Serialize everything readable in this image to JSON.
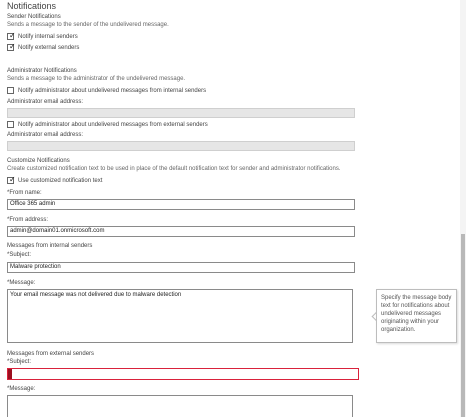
{
  "title": "Notifications",
  "sender": {
    "heading": "Sender Notifications",
    "description": "Sends a message to the sender of the undelivered message.",
    "notify_internal": "Notify internal senders",
    "notify_external": "Notify external senders"
  },
  "admin": {
    "heading": "Administrator Notifications",
    "description": "Sends a message to the administrator of the undelivered message.",
    "notify_internal": "Notify administrator about undelivered messages from internal senders",
    "email_label_1": "Administrator email address:",
    "notify_external": "Notify administrator about undelivered messages from external senders",
    "email_label_2": "Administrator email address:"
  },
  "custom": {
    "heading": "Customize Notifications",
    "description": "Create customized notification text to be used in place of the default notification text for sender and administrator notifications.",
    "use_custom": "Use customized notification text",
    "from_name_label": "*From name:",
    "from_name_value": "Office 365 admin",
    "from_address_label": "*From address:",
    "from_address_value": "admin@domain01.onmicrosoft.com"
  },
  "internal": {
    "heading": "Messages from internal senders",
    "subject_label": "*Subject:",
    "subject_value": "Malware protection",
    "message_label": "*Message:",
    "message_value": "Your email message was not delivered due to malware detection"
  },
  "tooltip": {
    "text": "Specify the message body text for notifications about undelivered messages originating within your organization."
  },
  "external": {
    "heading": "Messages from external senders",
    "subject_label": "*Subject:",
    "subject_value": "",
    "message_label": "*Message:"
  },
  "colors": {
    "error_border": "#d9223b",
    "error_marker": "#9c0f1f"
  }
}
